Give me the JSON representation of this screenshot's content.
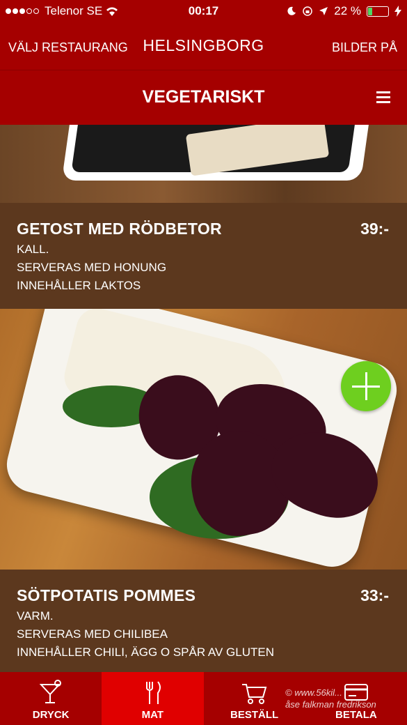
{
  "status_bar": {
    "carrier": "Telenor SE",
    "time": "00:17",
    "battery_percent": "22 %",
    "battery_level": 0.22
  },
  "top_nav": {
    "left_label": "VÄLJ RESTAURANG",
    "title": "HELSINGBORG",
    "right_label": "BILDER PÅ"
  },
  "category": {
    "title": "VEGETARISKT"
  },
  "items": [
    {
      "name": "GETOST MED RÖDBETOR",
      "price": "39:-",
      "lines": [
        "KALL.",
        "SERVERAS MED HONUNG",
        "INNEHÅLLER LAKTOS"
      ]
    },
    {
      "name": "SÖTPOTATIS POMMES",
      "price": "33:-",
      "lines": [
        "VARM.",
        "SERVERAS MED CHILIBEA",
        "INNEHÅLLER CHILI, ÄGG O SPÅR AV GLUTEN"
      ]
    }
  ],
  "tabs": [
    {
      "label": "DRYCK",
      "icon": "cocktail-icon"
    },
    {
      "label": "MAT",
      "icon": "cutlery-icon",
      "active": true
    },
    {
      "label": "BESTÄLL",
      "icon": "cart-icon"
    },
    {
      "label": "BETALA",
      "icon": "card-icon"
    }
  ],
  "watermark": {
    "line1": "© www.56kil...",
    "line2": "åse falkman fredrikson"
  },
  "colors": {
    "brand_red": "#a50000",
    "active_tab": "#e00000",
    "add_button": "#6ecf1f"
  }
}
